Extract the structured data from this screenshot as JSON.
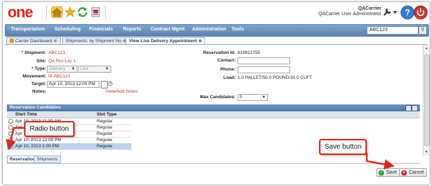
{
  "header": {
    "logo_text": "one",
    "user_name": "QACarrier",
    "user_role": "QACarrier User Administrator",
    "help_label": "?"
  },
  "nav": {
    "items": [
      "Transportation",
      "Scheduling",
      "Financials",
      "Reports",
      "Contract Mgmt",
      "Administration",
      "Tools"
    ],
    "search_value": "ABC123"
  },
  "tabs": [
    {
      "label": "Carrier Dashboard"
    },
    {
      "label": "Shipments: by Shipment No"
    },
    {
      "label": "View Live Delivery Appointment"
    }
  ],
  "form": {
    "shipment_label": "Shipment:",
    "shipment_value": "ABC123",
    "site_label": "Site:",
    "site_value": "QA Rcv Loc 1",
    "type_label": "Type:",
    "type_value": "Delivery",
    "type_value2": "Live",
    "movement_label": "Movement:",
    "movement_value": "M-ABC123",
    "target_label": "Target:",
    "target_value": "Apr 10, 2013 12:00 PM",
    "notes_label": "Notes:",
    "notes_link": "View/Add Notes",
    "reservation_id_label": "Reservation Id:",
    "reservation_id_value": "819912755",
    "contact_label": "Contact:",
    "phone_label": "Phone:",
    "load_label": "Load:",
    "load_value": "1.0 PALLET/50.0 POUND/30.0 CUFT",
    "max_candidates_label": "Max Candidates:",
    "max_candidates_value": "5"
  },
  "grid": {
    "title": "Reservation Candidates",
    "columns": [
      "Start Time",
      "Slot Type"
    ],
    "rows": [
      {
        "start": "Apr 10, 2013 11:00 AM",
        "slot": "Regular",
        "selected": false
      },
      {
        "start": "Apr 10, 2013 11:00 AM",
        "slot": "Regular",
        "selected": false
      },
      {
        "start": "Apr 10, 2013 11:00 AM",
        "slot": "Regular",
        "selected": false
      },
      {
        "start": "Apr 10, 2013 12:00 PM",
        "slot": "Regular",
        "selected": false
      },
      {
        "start": "Apr 10, 2013 1:00 PM",
        "slot": "Regular",
        "selected": true
      }
    ]
  },
  "bottom_tabs": [
    "Reservation",
    "Shipments"
  ],
  "buttons": {
    "save": "Save",
    "cancel": "Cancel"
  },
  "annotations": {
    "radio_callout": "Radio button",
    "save_callout": "Save button"
  },
  "colors": {
    "nav_bg": "#5b83b0",
    "logo": "#e2231a",
    "callout_border": "#d6281e",
    "selected_row": "#bcd3ee"
  }
}
